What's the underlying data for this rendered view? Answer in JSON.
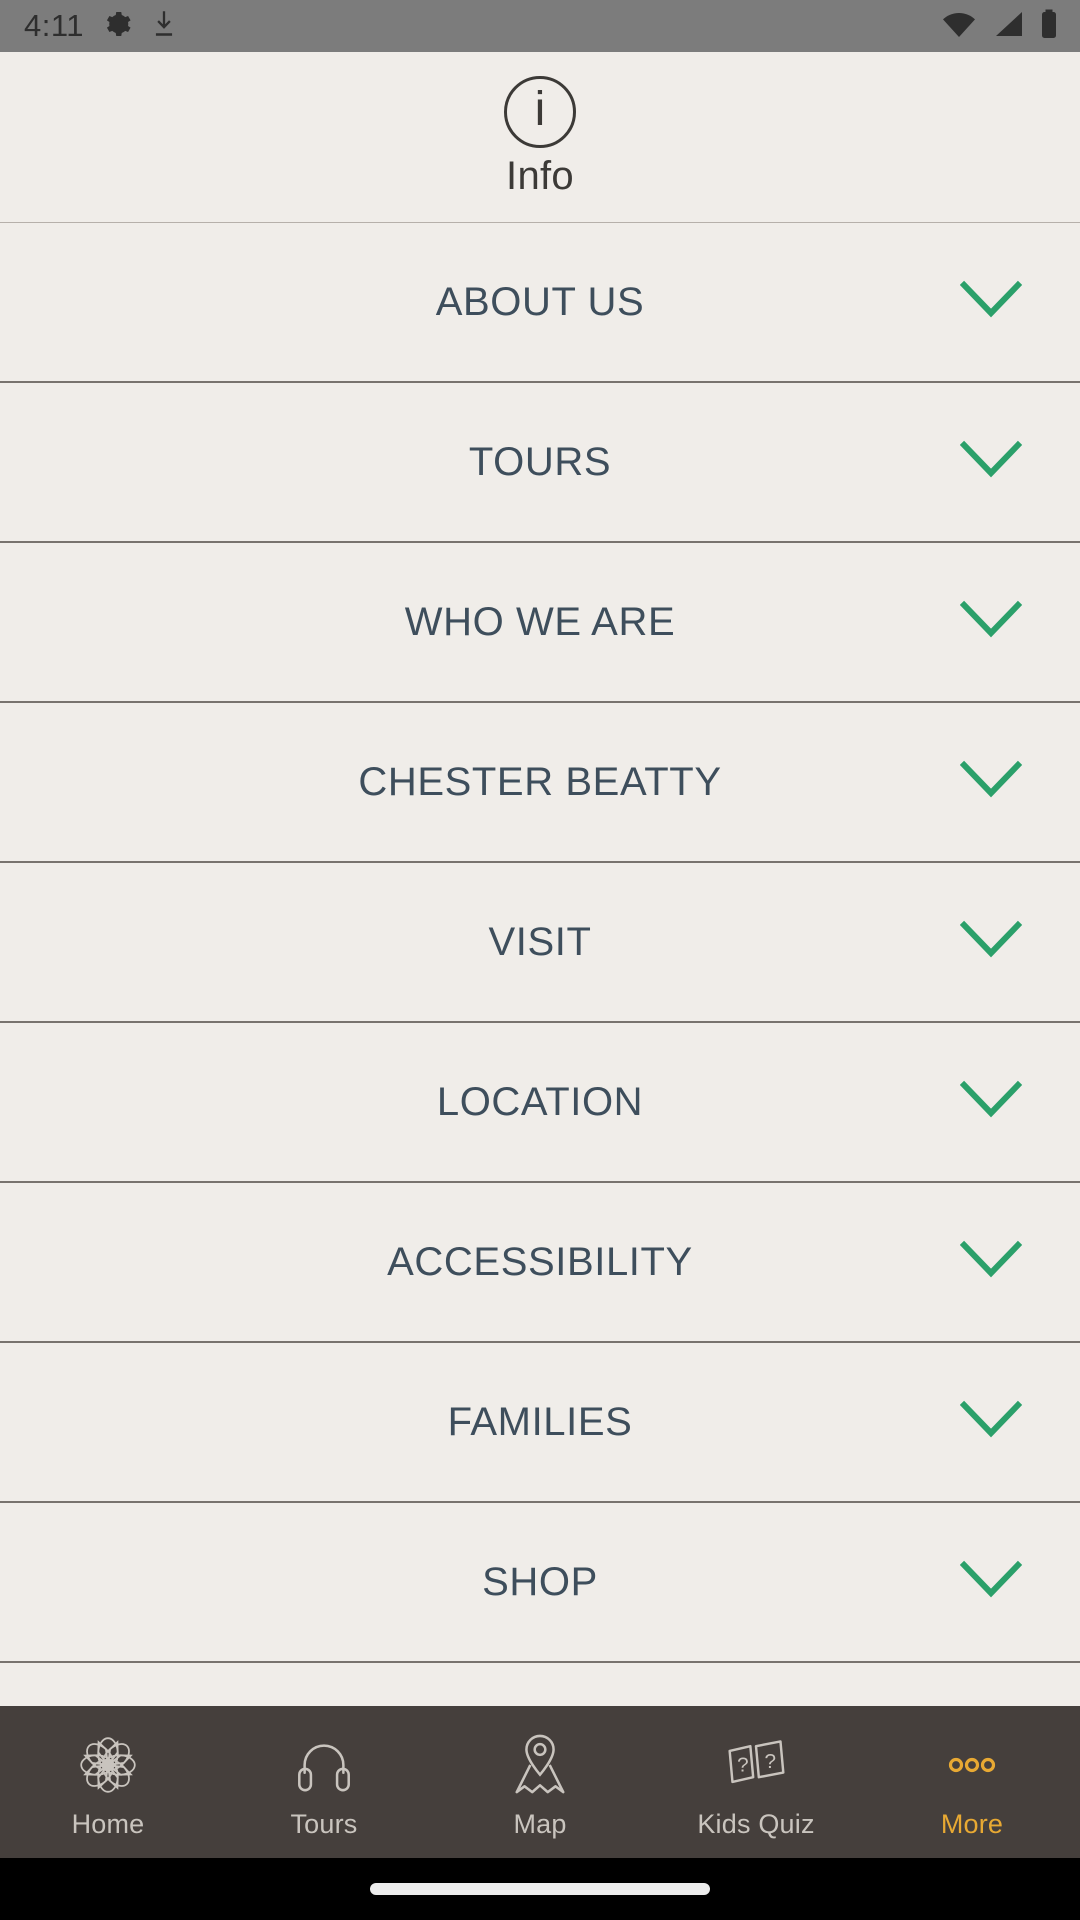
{
  "statusbar": {
    "time": "4:11",
    "left_icons": [
      "settings-gear-icon",
      "download-icon"
    ],
    "right_icons": [
      "wifi-icon",
      "cellular-signal-icon",
      "battery-icon"
    ],
    "background_color": "#7C7C7C"
  },
  "header": {
    "icon": "info-circle-icon",
    "icon_glyph": "i",
    "title": "Info",
    "background_color": "#F0EDE9",
    "text_color": "#3C3A37"
  },
  "list": {
    "chevron_icon": "chevron-down-icon",
    "chevron_color": "#2BA06A",
    "label_color": "#3E4E5C",
    "divider_color": "#78736E",
    "items": [
      {
        "label": "ABOUT US"
      },
      {
        "label": "TOURS"
      },
      {
        "label": "WHO WE ARE"
      },
      {
        "label": "CHESTER BEATTY"
      },
      {
        "label": "VISIT"
      },
      {
        "label": "LOCATION"
      },
      {
        "label": "ACCESSIBILITY"
      },
      {
        "label": "FAMILIES"
      },
      {
        "label": "SHOP"
      }
    ]
  },
  "bottomnav": {
    "background_color": "#453F3C",
    "inactive_color": "#C9C4BE",
    "active_color": "#E8A933",
    "items": [
      {
        "label": "Home",
        "icon": "rosette-flower-icon",
        "active": false
      },
      {
        "label": "Tours",
        "icon": "headphones-icon",
        "active": false
      },
      {
        "label": "Map",
        "icon": "map-pin-icon",
        "active": false
      },
      {
        "label": "Kids Quiz",
        "icon": "quiz-cards-icon",
        "active": false
      },
      {
        "label": "More",
        "icon": "three-dots-icon",
        "active": true
      }
    ]
  },
  "gesturebar": {
    "indicator": "home-indicator-pill"
  }
}
